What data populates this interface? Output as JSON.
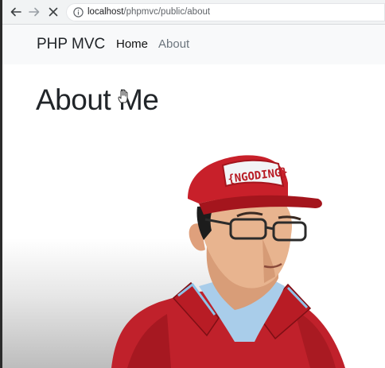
{
  "browser": {
    "url_host": "localhost",
    "url_path": "/phpmvc/public/about",
    "icons": {
      "back": "arrow-left-icon",
      "forward": "arrow-right-icon",
      "stop": "close-icon",
      "site_info": "info-icon"
    }
  },
  "navbar": {
    "brand": "PHP MVC",
    "links": [
      {
        "label": "Home",
        "active": true
      },
      {
        "label": "About",
        "active": false
      }
    ]
  },
  "page": {
    "title": "About Me"
  },
  "portrait": {
    "cap_text": "{NGODING}",
    "colors": {
      "cap": "#c8202a",
      "shirt": "#c0212b",
      "collar_accent": "#8ec3e8",
      "skin": "#e8b48f",
      "hair": "#1c1c1c"
    }
  }
}
